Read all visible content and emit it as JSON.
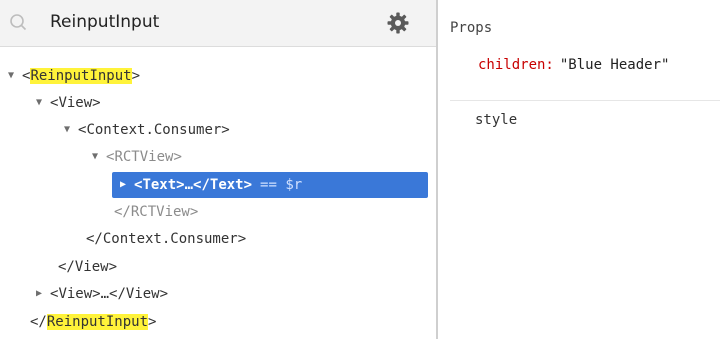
{
  "search": {
    "value": "ReinputInput"
  },
  "icons": {
    "search": "search-icon",
    "settings": "gear-icon"
  },
  "tree": {
    "rows": [
      {
        "arrow": "▼",
        "open": "<",
        "name": "ReinputInput",
        "close": ">"
      },
      {
        "arrow": "▼",
        "open": "<",
        "name": "View",
        "close": ">"
      },
      {
        "arrow": "▼",
        "open": "<",
        "name": "Context.Consumer",
        "close": ">"
      },
      {
        "arrow": "▼",
        "open": "<",
        "name": "RCTView",
        "close": ">"
      },
      {
        "arrow": "▶",
        "open": "<",
        "name": "Text",
        "close": ">",
        "ellipsis": "…",
        "end": "</Text>",
        "ref": "== $r"
      },
      {
        "open": "</",
        "name": "RCTView",
        "close": ">"
      },
      {
        "open": "</",
        "name": "Context.Consumer",
        "close": ">"
      },
      {
        "open": "</",
        "name": "View",
        "close": ">"
      },
      {
        "arrow": "▶",
        "open": "<",
        "name": "View",
        "close": ">",
        "ellipsis": "…",
        "end": "</View>"
      },
      {
        "open": "</",
        "name": "ReinputInput",
        "close": ">"
      }
    ]
  },
  "props": {
    "title": "Props",
    "children_key": "children:",
    "children_value": "\"Blue Header\"",
    "style_label": "style"
  },
  "colors": {
    "selection": "#3a78d8",
    "highlight": "#fff33a",
    "prop_key": "#c80000"
  }
}
